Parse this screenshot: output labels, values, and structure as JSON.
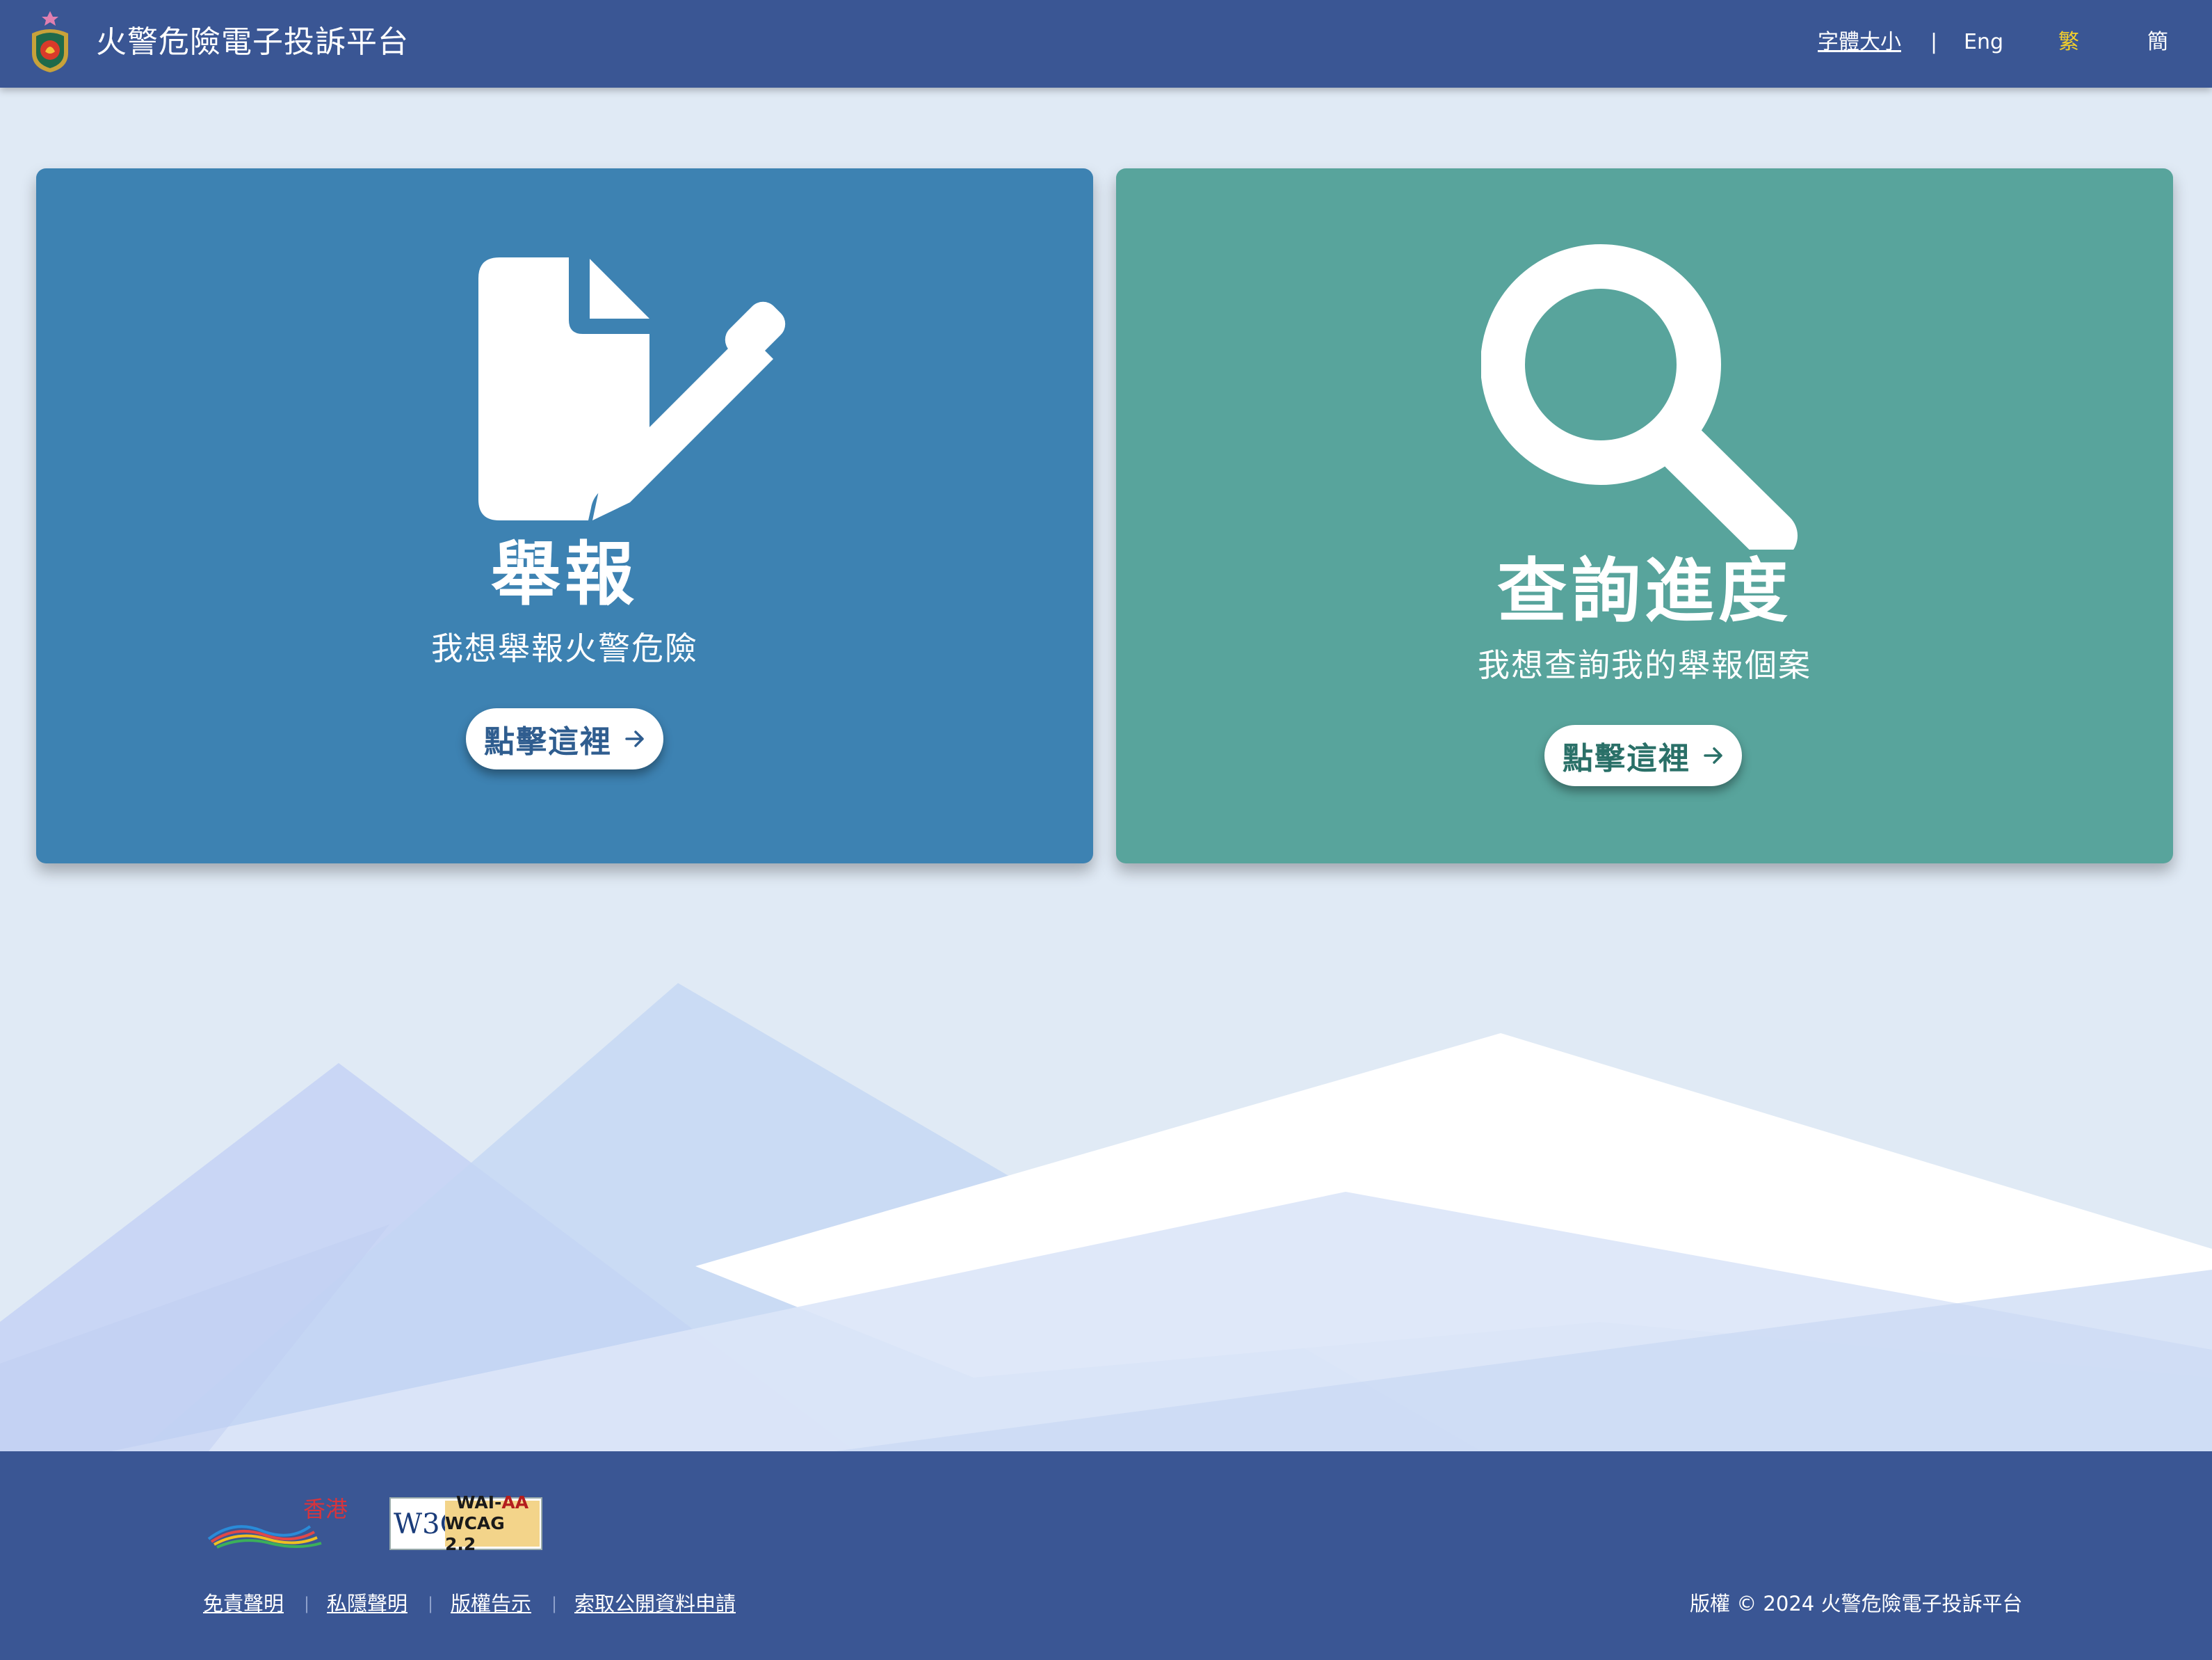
{
  "header": {
    "site_title": "火警危險電子投訴平台",
    "font_size_label": "字體大小",
    "separator": "|",
    "lang_eng": "Eng",
    "lang_trad": "繁",
    "lang_simp": "簡"
  },
  "cards": {
    "report": {
      "title": "舉報",
      "subtitle": "我想舉報火警危險",
      "button_label": "點擊這裡"
    },
    "track": {
      "title": "查詢進度",
      "subtitle": "我想查詢我的舉報個案",
      "button_label": "點擊這裡"
    }
  },
  "footer": {
    "brand_hk_text": "香港",
    "w3c_logo_text": "W3C",
    "w3c_wai": "WAI-",
    "w3c_aa": "AA",
    "w3c_wcag": "WCAG 2.2",
    "links": [
      "免責聲明",
      "私隱聲明",
      "版權告示",
      "索取公開資料申請"
    ],
    "copyright": "版權 © 2024  火警危險電子投訴平台"
  },
  "colors": {
    "header_bg": "#3a5694",
    "report_card": "#3d82b2",
    "track_card": "#58a49c",
    "active_lang": "#f5d02a",
    "page_bg": "#e0eaf5"
  },
  "icons": {
    "report": "file-signature-icon",
    "track": "search-icon",
    "button": "arrow-right-icon"
  }
}
